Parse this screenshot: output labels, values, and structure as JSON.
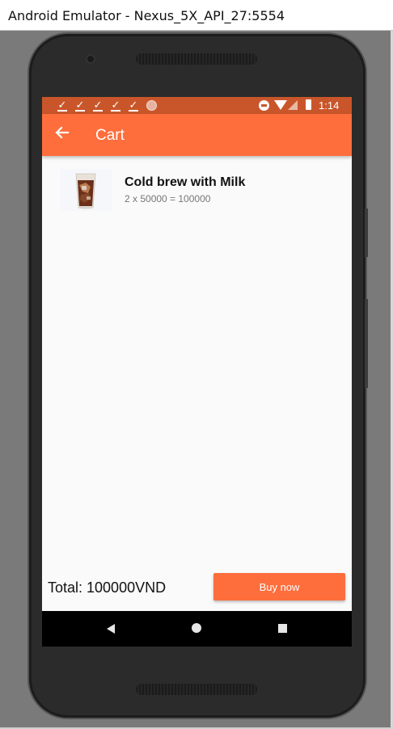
{
  "window": {
    "title": "Android Emulator - Nexus_5X_API_27:5554"
  },
  "statusbar": {
    "notification_icons": [
      "check-icon",
      "check-icon",
      "check-icon",
      "check-icon",
      "check-icon"
    ],
    "time": "1:14"
  },
  "appbar": {
    "title": "Cart",
    "back_icon": "arrow-left-icon"
  },
  "cart": {
    "items": [
      {
        "name": "Cold brew with Milk",
        "detail": "2 x 50000 = 100000",
        "image": "iced-coffee-glass"
      }
    ],
    "total_label": "Total: 100000VND",
    "buy_label": "Buy now"
  },
  "colors": {
    "accent": "#fd6e3c",
    "statusbar": "#c9562a",
    "background": "#fafafa"
  }
}
